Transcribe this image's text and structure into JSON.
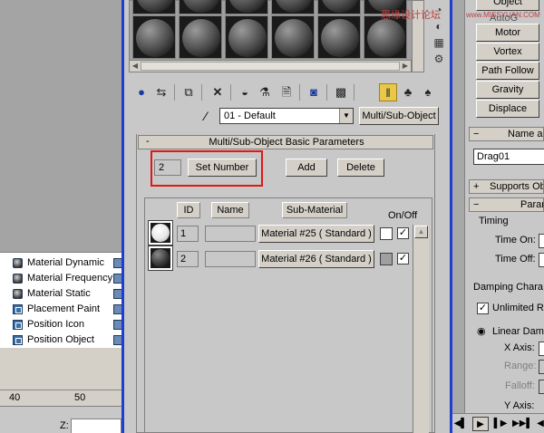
{
  "left_list": {
    "items": [
      {
        "label": "Material Dynamic",
        "icon": "sphere-icon"
      },
      {
        "label": "Material Frequency",
        "icon": "sphere-icon"
      },
      {
        "label": "Material Static",
        "icon": "sphere-icon"
      },
      {
        "label": "Placement Paint",
        "icon": "target-icon"
      },
      {
        "label": "Position Icon",
        "icon": "target-icon"
      },
      {
        "label": "Position Object",
        "icon": "target-icon"
      }
    ]
  },
  "timeline": {
    "tick_40": "40",
    "tick_50": "50"
  },
  "coord": {
    "z_label": "Z:"
  },
  "material_editor": {
    "material_name": "01 - Default",
    "material_type": "Multi/Sub-Object",
    "rollout_title": "Multi/Sub-Object Basic Parameters",
    "rollout_toggle": "-",
    "count_value": "2",
    "set_number_label": "Set Number",
    "add_label": "Add",
    "delete_label": "Delete",
    "headers": {
      "id": "ID",
      "name": "Name",
      "sub_material": "Sub-Material",
      "on_off": "On/Off"
    },
    "rows": [
      {
        "id": "1",
        "name": "",
        "sub_material": "Material #25  ( Standard )",
        "color": "#ffffff",
        "checked": "✓",
        "swatch": "white"
      },
      {
        "id": "2",
        "name": "",
        "sub_material": "Material #26  ( Standard )",
        "color": "#a0a0a0",
        "checked": "✓",
        "swatch": "dark"
      }
    ]
  },
  "command_panel": {
    "top_label": "Object",
    "auto_label": "AutoG",
    "buttons": [
      "Motor",
      "Vortex",
      "Path Follow",
      "Gravity",
      "Displace"
    ],
    "name_header": "Name and",
    "name_value": "Drag01",
    "supports_header": "Supports Obj",
    "params_header": "Param",
    "timing_label": "Timing",
    "time_on_label": "Time On:",
    "time_off_label": "Time Off:",
    "damping_label": "Damping Chara",
    "unlimited_label": "Unlimited Ra",
    "linear_label": "Linear Damp",
    "x_axis_label": "X Axis:",
    "range_label": "Range:",
    "falloff_label": "Falloff:",
    "y_axis_label": "Y Axis:"
  },
  "watermark": {
    "text": "思缘设计论坛",
    "site": "www.MISSYUAN.COM"
  }
}
